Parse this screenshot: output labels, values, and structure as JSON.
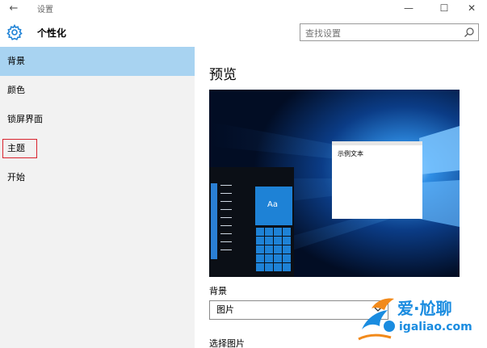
{
  "window": {
    "title": "设置",
    "back_glyph": "←",
    "min_glyph": "—",
    "max_glyph": "☐",
    "close_glyph": "✕"
  },
  "header": {
    "title": "个性化",
    "search_placeholder": "查找设置",
    "search_value": "查找设置"
  },
  "sidebar": {
    "items": [
      {
        "label": "背景",
        "active": true
      },
      {
        "label": "颜色",
        "active": false
      },
      {
        "label": "锁屏界面",
        "active": false
      },
      {
        "label": "主题",
        "active": false,
        "highlighted": true
      },
      {
        "label": "开始",
        "active": false
      }
    ]
  },
  "main": {
    "preview_title": "预览",
    "preview": {
      "sample_text": "示例文本",
      "tile_text": "Aa"
    },
    "background_label": "背景",
    "background_value": "图片",
    "choose_picture_label": "选择图片"
  },
  "watermark": {
    "name": "爱·尬聊",
    "url": "igaliao.com"
  },
  "colors": {
    "accent": "#1e82d6",
    "selected_nav": "#a8d3f1",
    "sidebar_bg": "#f2f2f2",
    "highlight_box": "#d9232e",
    "watermark_blue": "#1a8ce0",
    "watermark_orange": "#f28a1b"
  },
  "icons": {
    "back": "back-arrow-icon",
    "settings": "gear-icon",
    "search": "search-icon",
    "dropdown": "chevron-down-icon"
  }
}
